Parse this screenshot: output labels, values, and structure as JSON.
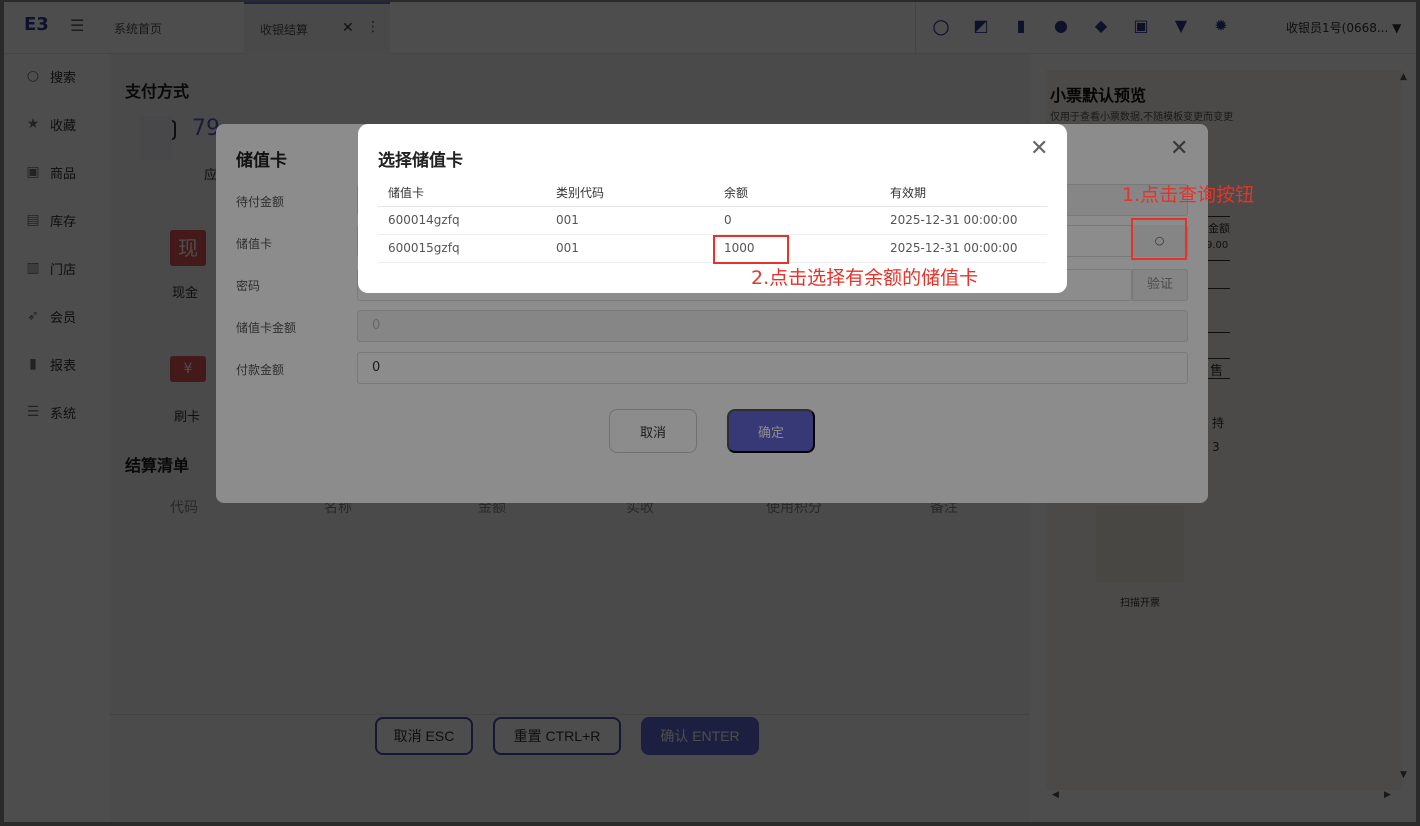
{
  "topbar": {
    "logo": "E3",
    "menu_toggle": "☰",
    "tabs": [
      {
        "label": "系统首页"
      },
      {
        "label": "收银结算"
      }
    ],
    "tab_close": "✕",
    "tab_more": "⋮",
    "icons": [
      "search-icon",
      "expand-icon",
      "clipboard-icon",
      "user-icon",
      "bulb-icon",
      "monitor-icon",
      "shirt-icon",
      "gear-icon"
    ],
    "user": "收银员1号(0668... ▼"
  },
  "sidebar": {
    "items": [
      {
        "icon": "search-icon",
        "glyph": "🔍",
        "label": "搜索"
      },
      {
        "icon": "star-icon",
        "glyph": "★",
        "label": "收藏"
      },
      {
        "icon": "goods-icon",
        "glyph": "▣",
        "label": "商品"
      },
      {
        "icon": "stock-icon",
        "glyph": "▤",
        "label": "库存"
      },
      {
        "icon": "store-icon",
        "glyph": "▥",
        "label": "门店"
      },
      {
        "icon": "rocket-icon",
        "glyph": "➶",
        "label": "会员"
      },
      {
        "icon": "chart-icon",
        "glyph": "▮",
        "label": "报表"
      },
      {
        "icon": "server-icon",
        "glyph": "☰",
        "label": "系统"
      }
    ]
  },
  "main": {
    "pay_title": "支付方式",
    "amount_partial": "79",
    "amount_label_partial": "应",
    "pay_cash_glyph": "现",
    "pay_cash_label": "现金",
    "pay_card_glyph": "¥",
    "pay_card_label": "刷卡",
    "settle_title": "结算清单",
    "columns": [
      "代码",
      "名称",
      "金额",
      "实收",
      "使用积分",
      "备注"
    ],
    "btn_cancel": "取消 ESC",
    "btn_reset": "重置 CTRL+R",
    "btn_confirm": "确认 ENTER"
  },
  "receipt": {
    "title": "小票默认预览",
    "subtitle": "仅用于查看小票数据,不随模板变更而变更",
    "frag_amount_label": "金额",
    "frag_amount": "9.00",
    "frag_sale": "售",
    "frag_support": "持",
    "frag_num": "3",
    "qr_label": "扫描开票"
  },
  "stored_value_dialog": {
    "title": "储值卡",
    "close": "✕",
    "fields": [
      {
        "label": "待付金额",
        "value": ""
      },
      {
        "label": "储值卡",
        "value": ""
      },
      {
        "label": "密码",
        "value": ""
      },
      {
        "label": "储值卡金额",
        "value": "0"
      },
      {
        "label": "付款金额",
        "value": "0"
      }
    ],
    "search_glyph": "○",
    "verify_label": "验证",
    "cancel_label": "取消",
    "confirm_label": "确定"
  },
  "select_card_dialog": {
    "title": "选择储值卡",
    "close": "✕",
    "headers": [
      "储值卡",
      "类别代码",
      "余额",
      "有效期"
    ],
    "rows": [
      {
        "card": "600014gzfq",
        "category": "001",
        "balance": "0",
        "expiry": "2025-12-31 00:00:00"
      },
      {
        "card": "600015gzfq",
        "category": "001",
        "balance": "1000",
        "expiry": "2025-12-31 00:00:00"
      }
    ]
  },
  "annotations": {
    "step1": "1.点击查询按钮",
    "step2": "2.点击选择有余额的储值卡",
    "color": "#e5332a"
  }
}
